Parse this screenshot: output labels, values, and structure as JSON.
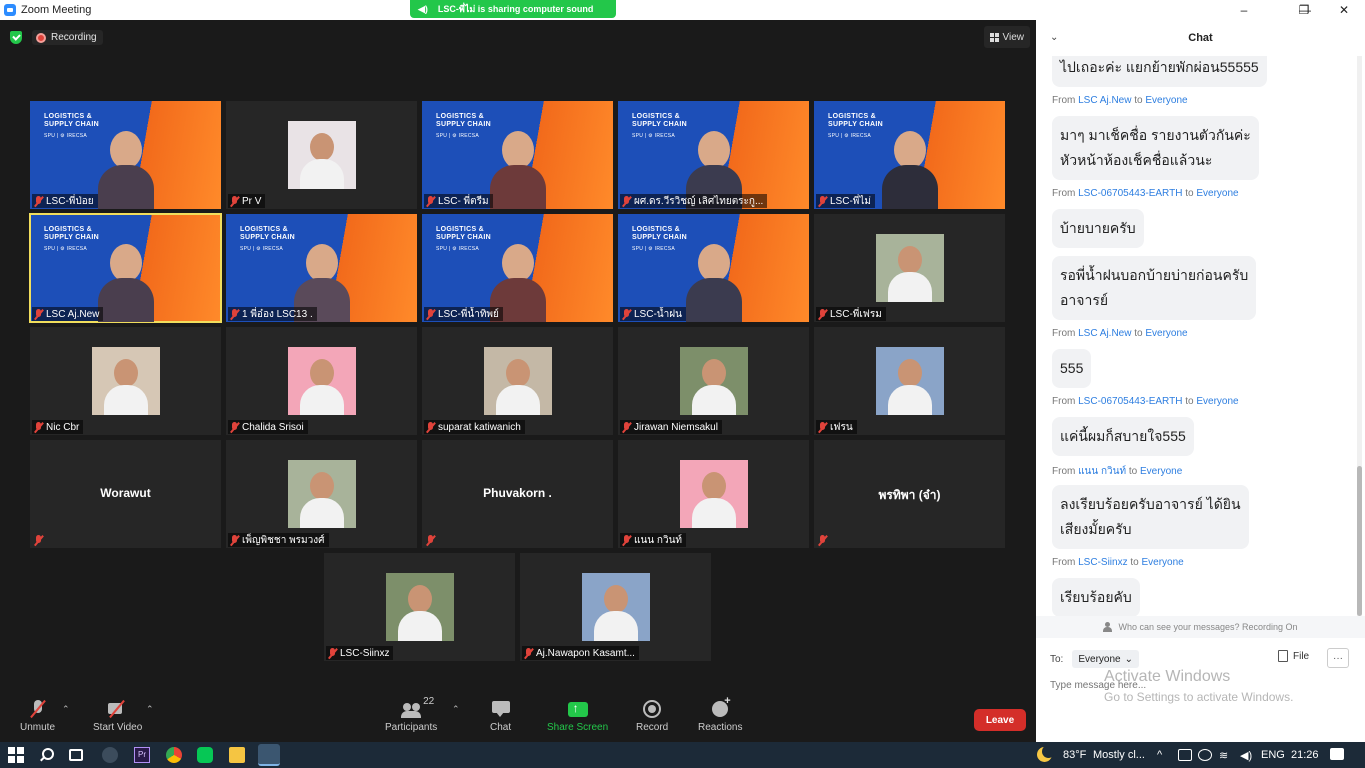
{
  "window": {
    "title": "Zoom Meeting",
    "sharing_banner": "LSC-พี่ไม่ is sharing computer sound"
  },
  "meeting": {
    "recording_label": "Recording",
    "view_label": "View",
    "tiles": [
      {
        "name": "LSC-พี่ป่อย",
        "type": "video"
      },
      {
        "name": "Pr V",
        "type": "photo"
      },
      {
        "name": "LSC- พี่ตรีม",
        "type": "video"
      },
      {
        "name": "ผศ.ดร.วีรวิชญ์ เลิศไทยตระกู...",
        "type": "video"
      },
      {
        "name": "LSC-พี่ไม่",
        "type": "video"
      },
      {
        "name": "LSC Aj.New",
        "type": "video",
        "active": true
      },
      {
        "name": "1 พี่อ๋อง LSC13 .",
        "type": "video"
      },
      {
        "name": "LSC-พี่น้ำทิพย์",
        "type": "video"
      },
      {
        "name": "LSC-น้ำฝน",
        "type": "video"
      },
      {
        "name": "LSC-พี่เฟรม",
        "type": "photo"
      },
      {
        "name": "Nic Cbr",
        "type": "photo"
      },
      {
        "name": "Chalida Srisoi",
        "type": "photo"
      },
      {
        "name": "suparat katiwanich",
        "type": "photo"
      },
      {
        "name": "Jirawan Niemsakul",
        "type": "photo"
      },
      {
        "name": "เฟรน",
        "type": "photo"
      },
      {
        "name": "Worawut",
        "type": "name"
      },
      {
        "name": "เพ็ญพิชชา พรมวงศ์",
        "type": "photo"
      },
      {
        "name": "Phuvakorn .",
        "type": "name"
      },
      {
        "name": "แนน กวินท์",
        "type": "photo"
      },
      {
        "name": "พรทิพา (จ๋า)",
        "type": "name"
      },
      {
        "name": "LSC-Siinxz",
        "type": "photo"
      },
      {
        "name": "Aj.Nawapon Kasamt...",
        "type": "photo"
      }
    ],
    "video_brand": {
      "line1": "LOGISTICS &",
      "line2": "SUPPLY CHAIN",
      "line3": "SPU | ⚙ IRECSA"
    }
  },
  "toolbar": {
    "unmute": "Unmute",
    "start_video": "Start Video",
    "participants": "Participants",
    "participants_count": "22",
    "chat": "Chat",
    "share_screen": "Share Screen",
    "record": "Record",
    "reactions": "Reactions",
    "leave": "Leave"
  },
  "chat": {
    "title": "Chat",
    "messages": [
      {
        "from": null,
        "to": null,
        "text": "ไปเถอะค่ะ แยกย้ายพักผ่อน55555"
      },
      {
        "from": "LSC Aj.New",
        "to": "Everyone",
        "text": "มาๆ มาเช็คชื่อ รายงานตัวกันค่ะ\nหัวหน้าห้องเช็คชื่อแล้วนะ"
      },
      {
        "from": "LSC-06705443-EARTH",
        "to": "Everyone",
        "text": "บ้ายบายครับ"
      },
      {
        "from": null,
        "to": null,
        "text": "รอพี่น้ำฝนบอกบ้ายบ่ายก่อนครับ\nอาจารย์"
      },
      {
        "from": "LSC Aj.New",
        "to": "Everyone",
        "text": "555"
      },
      {
        "from": "LSC-06705443-EARTH",
        "to": "Everyone",
        "text": "แค่นี้ผมก็สบายใจ555"
      },
      {
        "from": "แนน กวินท์",
        "to": "Everyone",
        "text": "ลงเรียบร้อยครับอาจารย์ ได้ยิน\nเสียงมั้ยครับ"
      },
      {
        "from": "LSC-Siinxz",
        "to": "Everyone",
        "text": "เรียบร้อยคับ"
      }
    ],
    "from_word": "From",
    "to_word": "to",
    "visibility_text": "Who can see your messages? Recording On",
    "to_label": "To:",
    "to_value": "Everyone",
    "file_label": "File",
    "more_label": "···",
    "input_placeholder": "Type message here..."
  },
  "watermark": {
    "line1": "Activate Windows",
    "line2": "Go to Settings to activate Windows."
  },
  "taskbar": {
    "weather": "83°F",
    "weather_desc": "Mostly cl...",
    "lang": "ENG",
    "time": "21:26"
  }
}
